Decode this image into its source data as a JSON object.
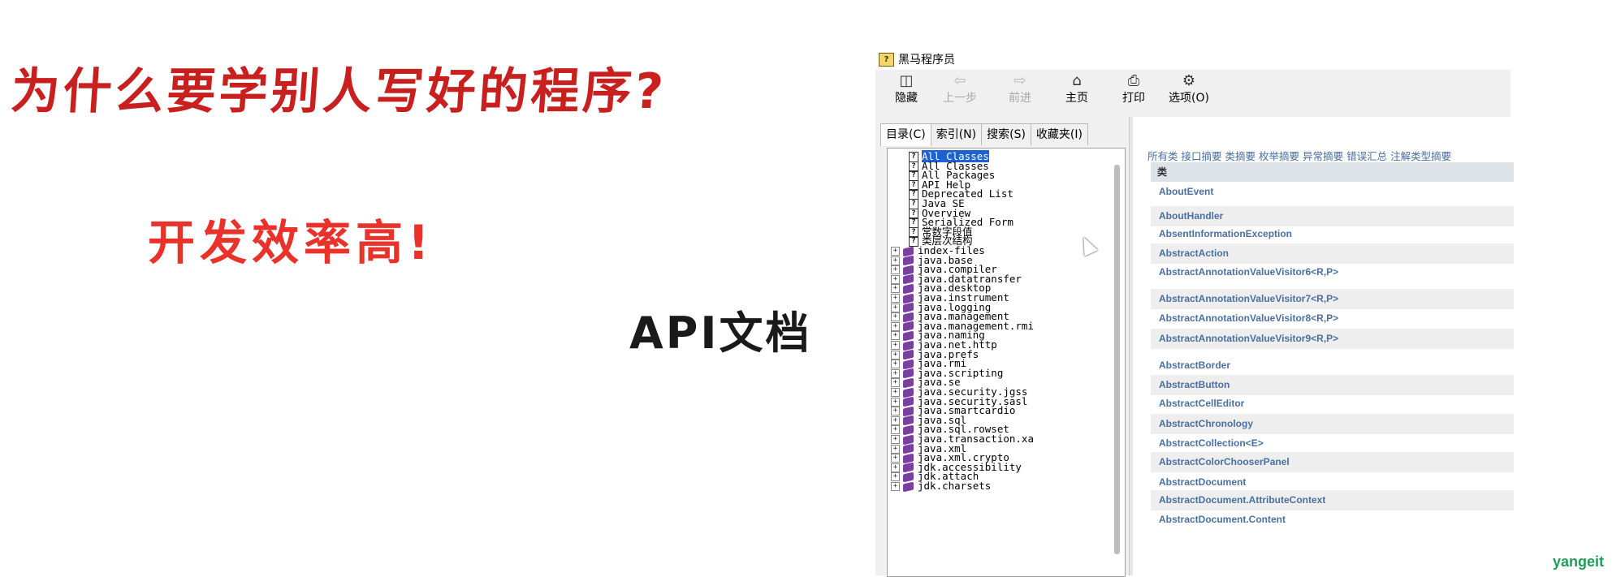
{
  "slide": {
    "title": "为什么要学别人写好的程序?",
    "subtitle": "开发效率高!",
    "api_label": "API文档",
    "watermark": "yangeit"
  },
  "window": {
    "title": "黑马程序员",
    "toolbar": [
      {
        "icon": "hide-pane-icon",
        "label": "隐藏",
        "enabled": true
      },
      {
        "icon": "back-arrow-icon",
        "label": "上一步",
        "enabled": false
      },
      {
        "icon": "forward-arrow-icon",
        "label": "前进",
        "enabled": false
      },
      {
        "icon": "home-icon",
        "label": "主页",
        "enabled": true
      },
      {
        "icon": "print-icon",
        "label": "打印",
        "enabled": true
      },
      {
        "icon": "options-icon",
        "label": "选项(O)",
        "enabled": true
      }
    ],
    "tabs": [
      "目录(C)",
      "索引(N)",
      "搜索(S)",
      "收藏夹(I)"
    ],
    "tree_items": [
      {
        "kind": "page",
        "text": "All Classes",
        "selected": true
      },
      {
        "kind": "page",
        "text": "All Classes"
      },
      {
        "kind": "page",
        "text": "All Packages"
      },
      {
        "kind": "page",
        "text": "API Help"
      },
      {
        "kind": "page",
        "text": "Deprecated List"
      },
      {
        "kind": "page",
        "text": "Java SE"
      },
      {
        "kind": "page",
        "text": "Overview"
      },
      {
        "kind": "page",
        "text": "Serialized Form"
      },
      {
        "kind": "page",
        "text": "常数字段值"
      },
      {
        "kind": "page",
        "text": "类层次结构"
      },
      {
        "kind": "book",
        "text": "index-files"
      },
      {
        "kind": "book",
        "text": "java.base"
      },
      {
        "kind": "book",
        "text": "java.compiler"
      },
      {
        "kind": "book",
        "text": "java.datatransfer"
      },
      {
        "kind": "book",
        "text": "java.desktop"
      },
      {
        "kind": "book",
        "text": "java.instrument"
      },
      {
        "kind": "book",
        "text": "java.logging"
      },
      {
        "kind": "book",
        "text": "java.management"
      },
      {
        "kind": "book",
        "text": "java.management.rmi"
      },
      {
        "kind": "book",
        "text": "java.naming"
      },
      {
        "kind": "book",
        "text": "java.net.http"
      },
      {
        "kind": "book",
        "text": "java.prefs"
      },
      {
        "kind": "book",
        "text": "java.rmi"
      },
      {
        "kind": "book",
        "text": "java.scripting"
      },
      {
        "kind": "book",
        "text": "java.se"
      },
      {
        "kind": "book",
        "text": "java.security.jgss"
      },
      {
        "kind": "book",
        "text": "java.security.sasl"
      },
      {
        "kind": "book",
        "text": "java.smartcardio"
      },
      {
        "kind": "book",
        "text": "java.sql"
      },
      {
        "kind": "book",
        "text": "java.sql.rowset"
      },
      {
        "kind": "book",
        "text": "java.transaction.xa"
      },
      {
        "kind": "book",
        "text": "java.xml"
      },
      {
        "kind": "book",
        "text": "java.xml.crypto"
      },
      {
        "kind": "book",
        "text": "jdk.accessibility"
      },
      {
        "kind": "book",
        "text": "jdk.attach"
      },
      {
        "kind": "book",
        "text": "jdk.charsets"
      }
    ],
    "summary_links": [
      "所有类",
      "接口摘要",
      "类摘要",
      "枚举摘要",
      "异常摘要",
      "错误汇总",
      "注解类型摘要"
    ],
    "table_header": "类",
    "classes": [
      "AboutEvent",
      "AboutHandler",
      "AbsentInformationException",
      "AbstractAction",
      "AbstractAnnotationValueVisitor6<R,P>",
      "AbstractAnnotationValueVisitor7<R,P>",
      "AbstractAnnotationValueVisitor8<R,P>",
      "AbstractAnnotationValueVisitor9<R,P>",
      "AbstractBorder",
      "AbstractButton",
      "AbstractCellEditor",
      "AbstractChronology",
      "AbstractCollection<E>",
      "AbstractColorChooserPanel",
      "AbstractDocument",
      "AbstractDocument.AttributeContext",
      "AbstractDocument.Content"
    ]
  }
}
